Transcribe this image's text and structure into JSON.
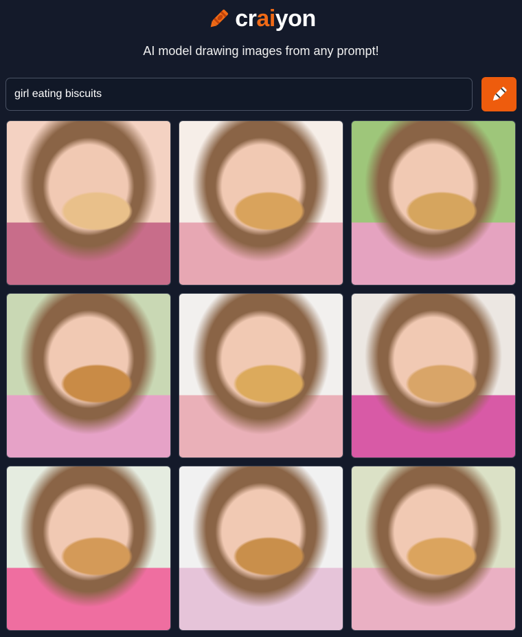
{
  "logo": {
    "part1": "cr",
    "part2": "ai",
    "part3": "yon",
    "icon": "crayon-icon"
  },
  "tagline": "AI model drawing images from any prompt!",
  "search": {
    "value": "girl eating biscuits"
  },
  "draw_button": {
    "icon": "crayon-icon"
  },
  "colors": {
    "background": "#141a2a",
    "accent": "#ee5c0d"
  },
  "images": [
    {
      "palette": [
        "#f4d2c2",
        "#c86d8a",
        "#e9c08a"
      ]
    },
    {
      "palette": [
        "#f6eee8",
        "#e7a7b3",
        "#d9a35c"
      ]
    },
    {
      "palette": [
        "#9ec67a",
        "#e5a3c0",
        "#d6a55e"
      ]
    },
    {
      "palette": [
        "#c9d8b4",
        "#e6a2c7",
        "#c98b46"
      ]
    },
    {
      "palette": [
        "#f2f0ee",
        "#eab0b8",
        "#dcaa5c"
      ]
    },
    {
      "palette": [
        "#ece7e2",
        "#d85aa6",
        "#d9a568"
      ]
    },
    {
      "palette": [
        "#e5ece0",
        "#ef6ea0",
        "#d49a58"
      ]
    },
    {
      "palette": [
        "#f1f1f1",
        "#e6c4d9",
        "#c98f4b"
      ]
    },
    {
      "palette": [
        "#dbe1c6",
        "#eab0c3",
        "#dba45e"
      ]
    }
  ]
}
